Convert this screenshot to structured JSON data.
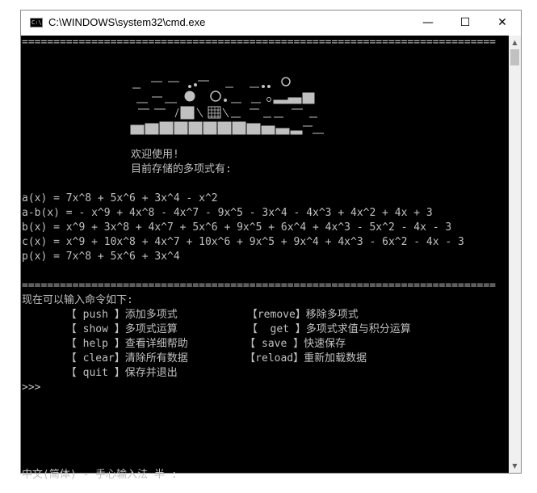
{
  "window": {
    "title": "C:\\WINDOWS\\system32\\cmd.exe",
    "icon_label": "C:\\",
    "minimize_glyph": "—",
    "maximize_glyph": "☐",
    "close_glyph": "✕"
  },
  "console": {
    "rule_top": "===========================================================================",
    "welcome": "欢迎使用!",
    "stored_intro": "目前存储的多项式有:",
    "polynomials": [
      "a(x) = 7x^8 + 5x^6 + 3x^4 - x^2",
      "a-b(x) = - x^9 + 4x^8 - 4x^7 - 9x^5 - 3x^4 - 4x^3 + 4x^2 + 4x + 3",
      "b(x) = x^9 + 3x^8 + 4x^7 + 5x^6 + 9x^5 + 6x^4 + 4x^3 - 5x^2 - 4x - 3",
      "c(x) = x^9 + 10x^8 + 4x^7 + 10x^6 + 9x^5 + 9x^4 + 4x^3 - 6x^2 - 4x - 3",
      "p(x) = 7x^8 + 5x^6 + 3x^4"
    ],
    "rule_bottom": "===========================================================================",
    "commands_intro": "现在可以输入命令如下:",
    "command_rows": [
      "       【 push 】添加多项式           【remove】移除多项式",
      "       【 show 】多项式运算           【  get 】多项式求值与积分运算",
      "       【 help 】查看详细帮助         【 save 】快速保存",
      "       【 clear】清除所有数据         【reload】重新加载数据",
      "       【 quit 】保存并退出"
    ],
    "prompt": ">>>",
    "ime_status": "中文(简体) - 手心输入法 半 :"
  },
  "scrollbar": {
    "up_glyph": "▲",
    "down_glyph": "▼"
  }
}
